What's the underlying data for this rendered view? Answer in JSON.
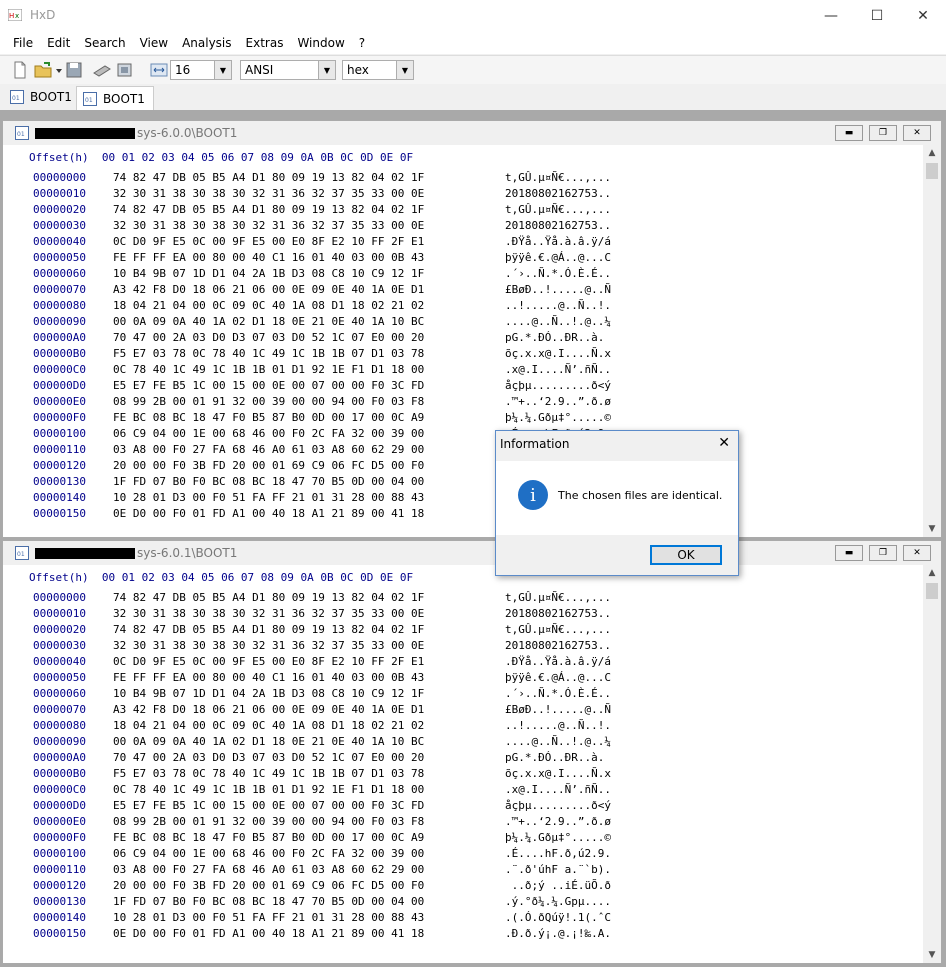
{
  "app": {
    "title": "HxD",
    "minimize": "—",
    "maximize": "☐",
    "close": "✕"
  },
  "menu": [
    "File",
    "Edit",
    "Search",
    "View",
    "Analysis",
    "Extras",
    "Window",
    "?"
  ],
  "toolbar": {
    "bytes_per_row": "16",
    "charset": "ANSI",
    "offset_base": "hex"
  },
  "tabs": [
    {
      "label": "BOOT1"
    },
    {
      "label": "BOOT1"
    }
  ],
  "panes": [
    {
      "title": "sys-6.0.0\\BOOT1"
    },
    {
      "title": "sys-6.0.1\\BOOT1"
    }
  ],
  "hex": {
    "header_offset": "Offset(h)",
    "header_cols": "00 01 02 03 04 05 06 07 08 09 0A 0B 0C 0D 0E 0F",
    "rows": [
      {
        "o": "00000000",
        "b": "74 82 47 DB 05 B5 A4 D1 80 09 19 13 82 04 02 1F",
        "t": "t,GÛ.µ¤Ñ€...,..."
      },
      {
        "o": "00000010",
        "b": "32 30 31 38 30 38 30 32 31 36 32 37 35 33 00 0E",
        "t": "20180802162753.."
      },
      {
        "o": "00000020",
        "b": "74 82 47 DB 05 B5 A4 D1 80 09 19 13 82 04 02 1F",
        "t": "t,GÛ.µ¤Ñ€...,..."
      },
      {
        "o": "00000030",
        "b": "32 30 31 38 30 38 30 32 31 36 32 37 35 33 00 0E",
        "t": "20180802162753.."
      },
      {
        "o": "00000040",
        "b": "0C D0 9F E5 0C 00 9F E5 00 E0 8F E2 10 FF 2F E1",
        "t": ".ÐŸå..Ÿå.à.â.ÿ/á"
      },
      {
        "o": "00000050",
        "b": "FE FF FF EA 00 80 00 40 C1 16 01 40 03 00 0B 43",
        "t": "þÿÿê.€.@Á..@...C"
      },
      {
        "o": "00000060",
        "b": "10 B4 9B 07 1D D1 04 2A 1B D3 08 C8 10 C9 12 1F",
        "t": ".´›..Ñ.*.Ó.È.É.."
      },
      {
        "o": "00000070",
        "b": "A3 42 F8 D0 18 06 21 06 00 0E 09 0E 40 1A 0E D1",
        "t": "£BøÐ..!.....@..Ñ"
      },
      {
        "o": "00000080",
        "b": "18 04 21 04 00 0C 09 0C 40 1A 08 D1 18 02 21 02",
        "t": "..!.....@..Ñ..!."
      },
      {
        "o": "00000090",
        "b": "00 0A 09 0A 40 1A 02 D1 18 0E 21 0E 40 1A 10 BC",
        "t": "....@..Ñ..!.@..¼"
      },
      {
        "o": "000000A0",
        "b": "70 47 00 2A 03 D0 D3 07 03 D0 52 1C 07 E0 00 20",
        "t": "pG.*.ÐÓ..ÐR..à. "
      },
      {
        "o": "000000B0",
        "b": "F5 E7 03 78 0C 78 40 1C 49 1C 1B 1B 07 D1 03 78",
        "t": "õç.x.x@.I....Ñ.x"
      },
      {
        "o": "000000C0",
        "b": "0C 78 40 1C 49 1C 1B 1B 01 D1 92 1E F1 D1 18 00",
        "t": ".x@.I....Ñ’.ñÑ.."
      },
      {
        "o": "000000D0",
        "b": "E5 E7 FE B5 1C 00 15 00 0E 00 07 00 00 F0 3C FD",
        "t": "åçþµ.........ð<ý"
      },
      {
        "o": "000000E0",
        "b": "08 99 2B 00 01 91 32 00 39 00 00 94 00 F0 03 F8",
        "t": ".™+..‘2.9..”.ð.ø"
      },
      {
        "o": "000000F0",
        "b": "FE BC 08 BC 18 47 F0 B5 87 B0 0D 00 17 00 0C A9",
        "t": "þ¼.¼.Gðµ‡°.....©"
      },
      {
        "o": "00000100",
        "b": "06 C9 04 00 1E 00 68 46 00 F0 2C FA 32 00 39 00",
        "t": ".É....hF.ð,ú2.9."
      },
      {
        "o": "00000110",
        "b": "03 A8 00 F0 27 FA 68 46 A0 61 03 A8 60 62 29 00",
        "t": ".¨.ð'úhF a.¨`b)."
      },
      {
        "o": "00000120",
        "b": "20 00 00 F0 3B FD 20 00 01 69 C9 06 FC D5 00 F0",
        "t": " ..ð;ý ..iÉ.üÕ.ð"
      },
      {
        "o": "00000130",
        "b": "1F FD 07 B0 F0 BC 08 BC 18 47 70 B5 0D 00 04 00",
        "t": ".ý.°ð¼.¼.Gpµ...."
      },
      {
        "o": "00000140",
        "b": "10 28 01 D3 00 F0 51 FA FF 21 01 31 28 00 88 43",
        "t": ".(.Ó.ðQúÿ!.1(.ˆC"
      },
      {
        "o": "00000150",
        "b": "0E D0 00 F0 01 FD A1 00 40 18 A1 21 89 00 41 18",
        "t": ".Ð.ð.ý¡.@.¡!‰.A."
      }
    ]
  },
  "dialog": {
    "title": "Information",
    "message": "The chosen files are identical.",
    "ok": "OK",
    "close": "✕"
  }
}
